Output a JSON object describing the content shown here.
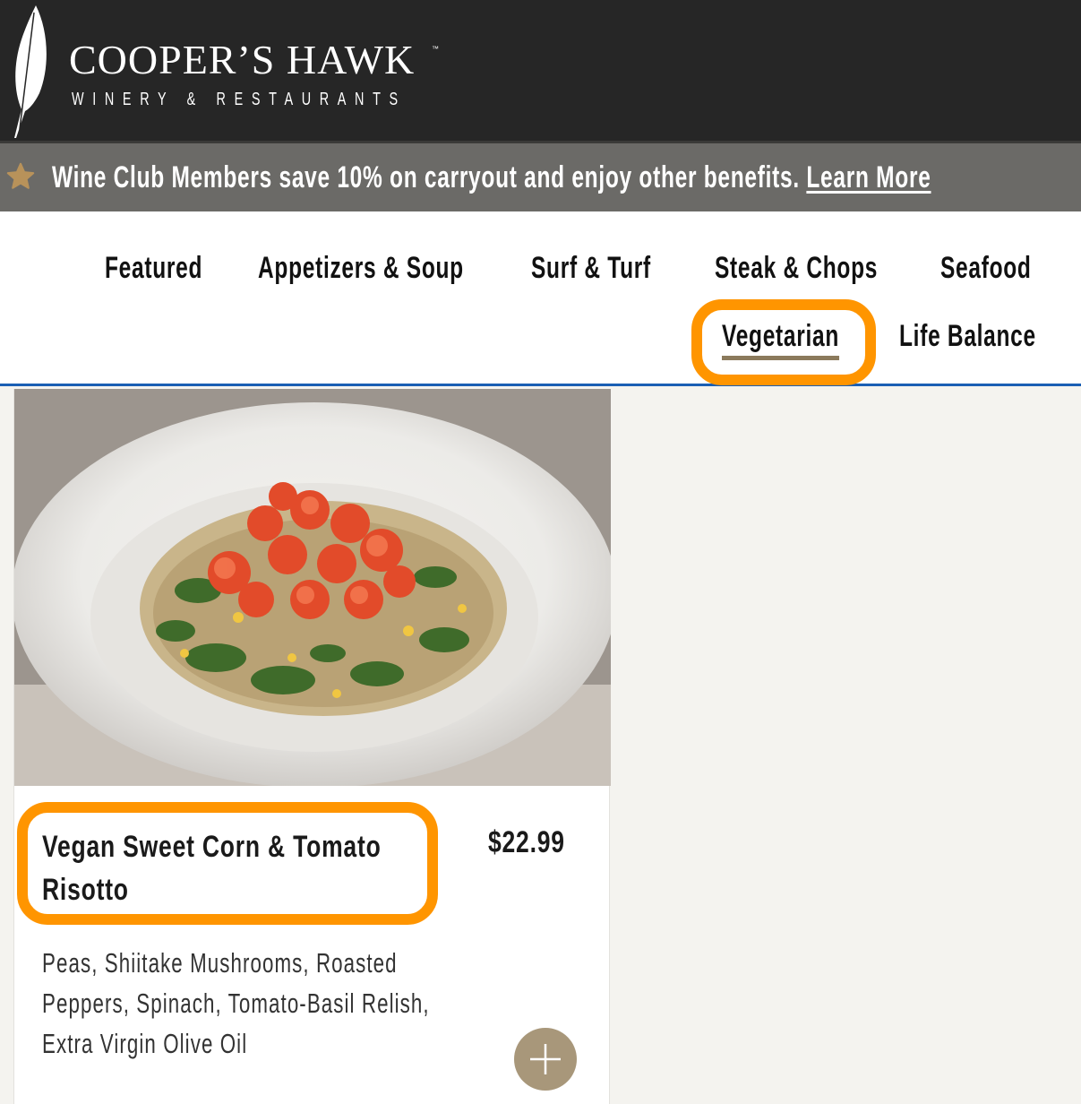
{
  "header": {
    "brand_name": "COOPER’S HAWK",
    "trademark": "™",
    "brand_subtitle": "WINERY & RESTAURANTS",
    "logo_icon": "feather-icon"
  },
  "promo": {
    "icon": "star-icon",
    "text": "Wine Club Members save 10% on carryout and enjoy other benefits. ",
    "link_label": "Learn More",
    "star_color": "#b8925a"
  },
  "nav": {
    "items": [
      {
        "label": "Featured"
      },
      {
        "label": "Appetizers & Soup"
      },
      {
        "label": "Surf & Turf"
      },
      {
        "label": "Steak & Chops"
      },
      {
        "label": "Seafood"
      },
      {
        "label": "Vegetarian",
        "active": true
      },
      {
        "label": "Life Balance"
      }
    ],
    "active_underline_color": "#8b7a5c",
    "border_color": "#1a5fb4"
  },
  "menu_item": {
    "image_alt": "Vegan Sweet Corn & Tomato Risotto dish",
    "title": "Vegan Sweet Corn & Tomato Risotto",
    "price": "$22.99",
    "description": "Peas, Shiitake Mushrooms, Roasted Peppers, Spinach, Tomato-Basil Relish, Extra Virgin Olive Oil",
    "add_button_icon": "plus-icon"
  },
  "annotations": {
    "highlight_color": "#ff9500"
  }
}
